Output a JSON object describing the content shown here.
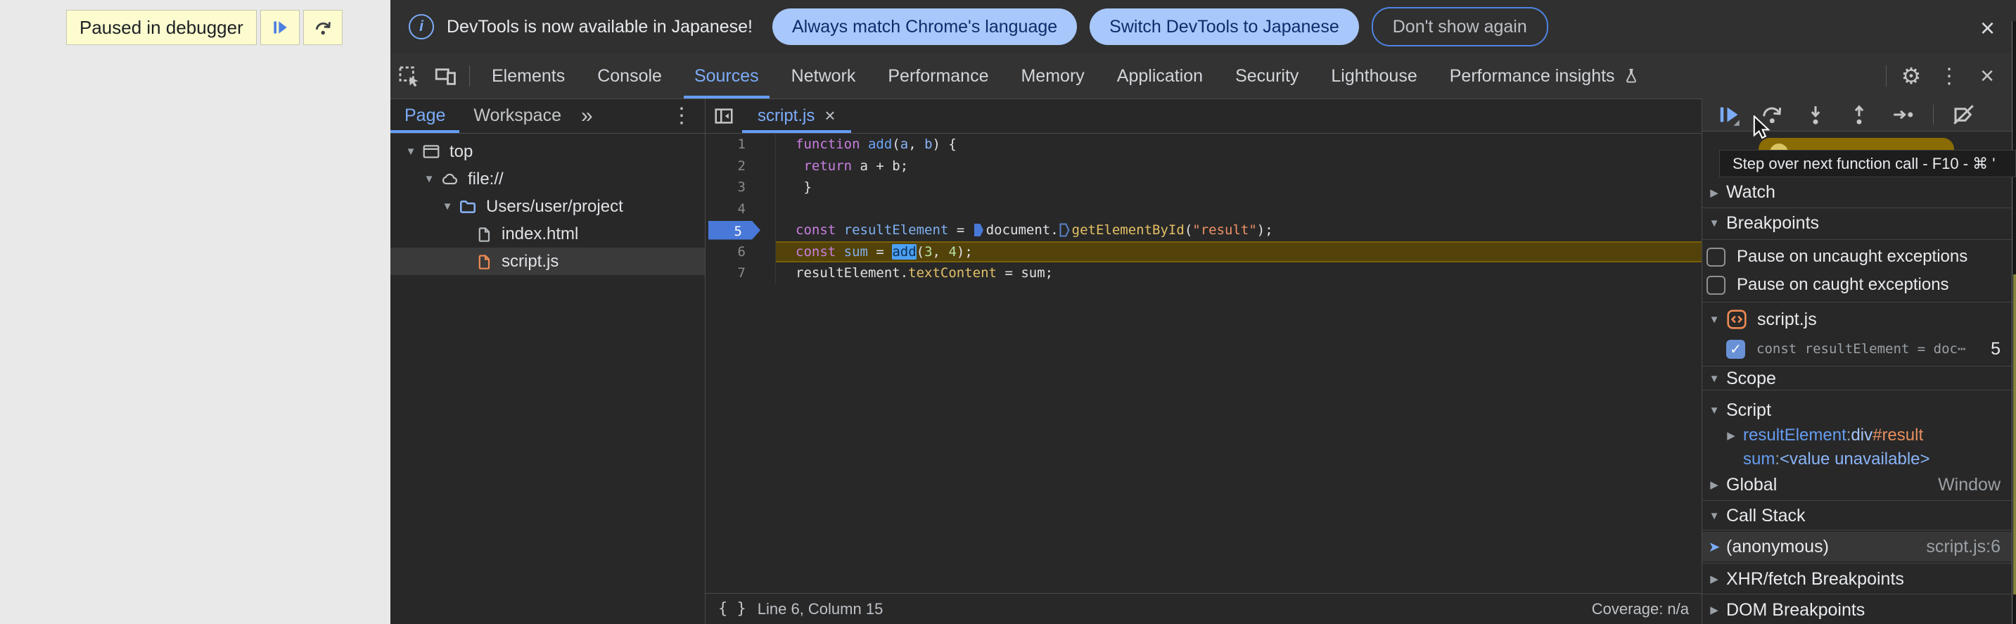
{
  "overlay": {
    "label": "Paused in debugger"
  },
  "notification": {
    "message": "DevTools is now available in Japanese!",
    "action_primary": "Always match Chrome's language",
    "action_secondary": "Switch DevTools to Japanese",
    "action_dismiss": "Don't show again"
  },
  "tabbar": {
    "selected": "Sources",
    "tabs": [
      {
        "label": "Elements"
      },
      {
        "label": "Console"
      },
      {
        "label": "Sources"
      },
      {
        "label": "Network"
      },
      {
        "label": "Performance"
      },
      {
        "label": "Memory"
      },
      {
        "label": "Application"
      },
      {
        "label": "Security"
      },
      {
        "label": "Lighthouse"
      },
      {
        "label": "Performance insights",
        "icon": "flask-icon"
      }
    ]
  },
  "navigator": {
    "tabs": {
      "page": "Page",
      "workspace": "Workspace"
    },
    "selected": "Page",
    "more_symbol": "»",
    "tree": [
      {
        "label": "top",
        "icon": "frame",
        "level": 0,
        "expanded": true
      },
      {
        "label": "file://",
        "icon": "cloud",
        "level": 1,
        "expanded": true
      },
      {
        "label": "Users/user/project",
        "icon": "folder",
        "level": 2,
        "expanded": true
      },
      {
        "label": "index.html",
        "icon": "file-html",
        "level": 3
      },
      {
        "label": "script.js",
        "icon": "file-js",
        "level": 3,
        "selected": true
      }
    ]
  },
  "editor": {
    "tab_label": "script.js",
    "breakpoint_line": 5,
    "paused_line": 6,
    "lines": [
      {
        "n": 1,
        "tokens": [
          [
            "kw",
            "function"
          ],
          [
            "pl",
            " "
          ],
          [
            "fn",
            "add"
          ],
          [
            "pl",
            "("
          ],
          [
            "pr",
            "a"
          ],
          [
            "pl",
            ", "
          ],
          [
            "pr",
            "b"
          ],
          [
            "pl",
            ") {"
          ]
        ]
      },
      {
        "n": 2,
        "tokens": [
          [
            "pl",
            " "
          ],
          [
            "kw",
            "return"
          ],
          [
            "pl",
            " a + b;"
          ]
        ]
      },
      {
        "n": 3,
        "tokens": [
          [
            "pl",
            " }"
          ]
        ]
      },
      {
        "n": 4,
        "tokens": []
      },
      {
        "n": 5,
        "tokens": [
          [
            "kw",
            "const"
          ],
          [
            "pl",
            " "
          ],
          [
            "vr",
            "resultElement"
          ],
          [
            "pl",
            " = "
          ],
          [
            "bpf",
            ""
          ],
          [
            "pl",
            "document."
          ],
          [
            "bph",
            ""
          ],
          [
            "fy",
            "getElementById"
          ],
          [
            "pl",
            "("
          ],
          [
            "st",
            "\"result\""
          ],
          [
            "pl",
            ");"
          ]
        ]
      },
      {
        "n": 6,
        "tokens": [
          [
            "kw",
            "const"
          ],
          [
            "pl",
            " "
          ],
          [
            "vr",
            "sum"
          ],
          [
            "pl",
            " = "
          ],
          [
            "sel",
            "add"
          ],
          [
            "pl",
            "("
          ],
          [
            "nm",
            "3"
          ],
          [
            "pl",
            ", "
          ],
          [
            "nm",
            "4"
          ],
          [
            "pl",
            ");"
          ]
        ]
      },
      {
        "n": 7,
        "tokens": [
          [
            "pl",
            "resultElement."
          ],
          [
            "fy",
            "textContent"
          ],
          [
            "pl",
            " = sum;"
          ]
        ]
      }
    ],
    "status": {
      "left": "Line 6, Column 15",
      "right": "Coverage: n/a"
    }
  },
  "debugger": {
    "tooltip": "Step over next function call - F10 - ⌘ '",
    "sections": {
      "watch": "Watch",
      "breakpoints": "Breakpoints",
      "scope": "Scope",
      "call_stack": "Call Stack",
      "xhr": "XHR/fetch Breakpoints",
      "dom": "DOM Breakpoints"
    },
    "breakpoints": {
      "pause_uncaught": "Pause on uncaught exceptions",
      "pause_caught": "Pause on caught exceptions",
      "file": "script.js",
      "entry_text": "const resultElement = doc⋯",
      "entry_line": "5"
    },
    "scope": {
      "script_label": "Script",
      "var1_name": "resultElement",
      "var1_sep": ": ",
      "var1_tag": "div",
      "var1_id": "#result",
      "var2_name": "sum",
      "var2_sep": ": ",
      "var2_value": "<value unavailable>",
      "global_label": "Global",
      "global_value": "Window"
    },
    "call_stack": {
      "frame": "(anonymous)",
      "location": "script.js:6"
    }
  },
  "colors": {
    "accent_blue": "#7cacf8",
    "pill_bg": "#a8c7fa",
    "pill_text": "#0c2d6b",
    "banner_bg": "#fdfccf",
    "breakpoint_blue": "#4878d8",
    "paused_line_bg": "#53430a",
    "keyword_purple": "#c87fe0",
    "function_yellow": "#e3c065",
    "string_orange": "#ee9266",
    "number_green": "#b6dfa6",
    "js_file_orange": "#ee8b55"
  }
}
